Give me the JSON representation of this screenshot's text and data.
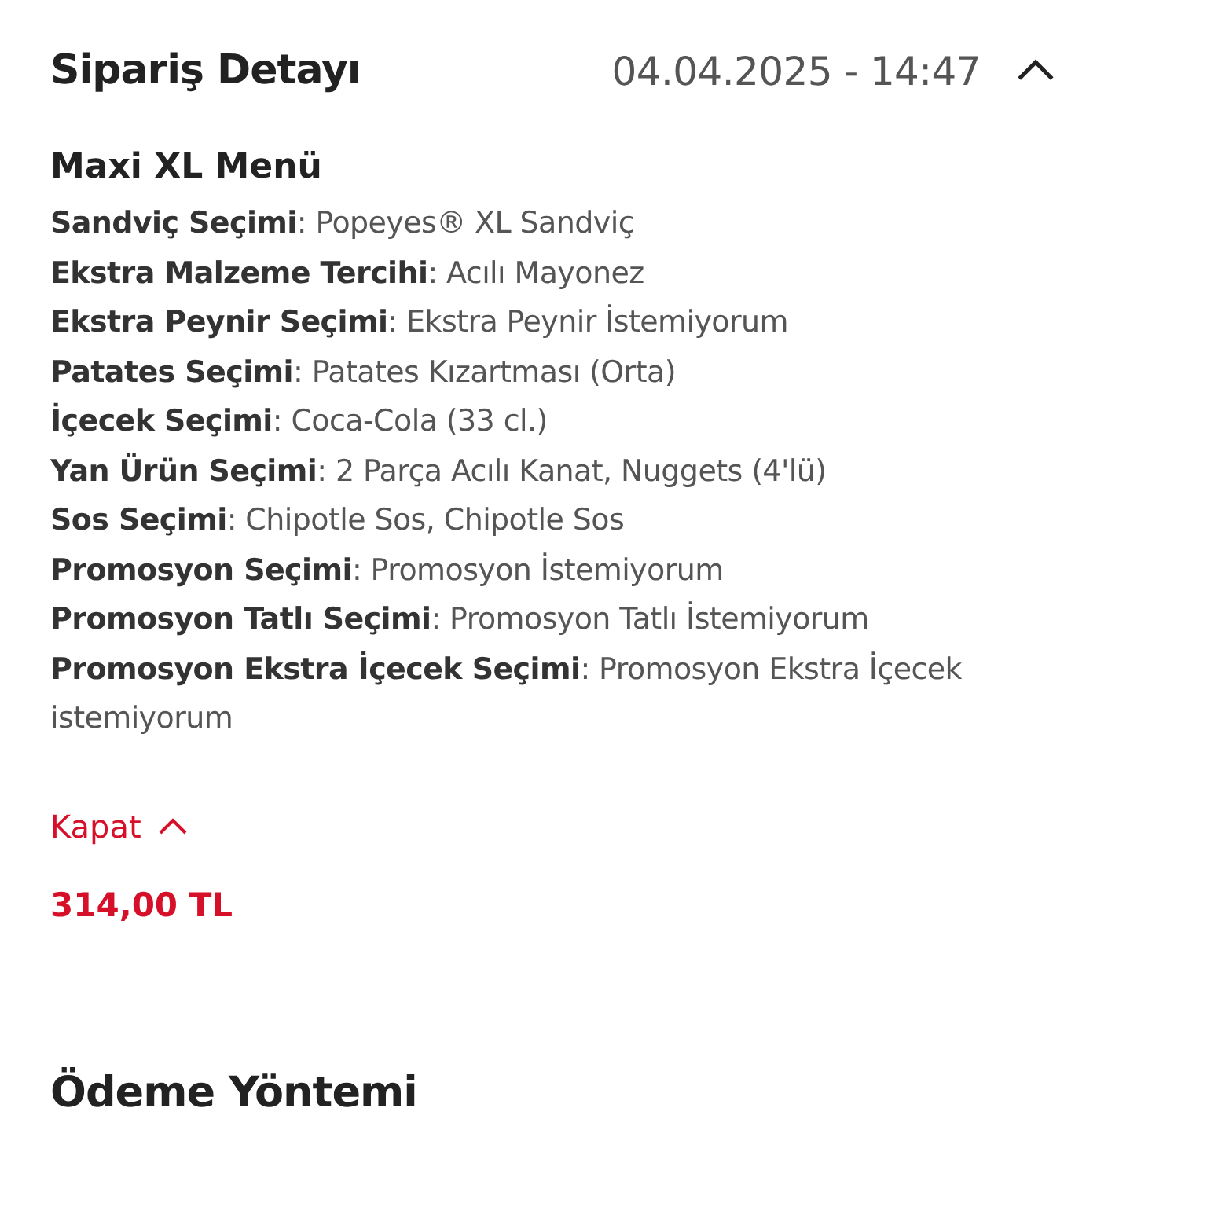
{
  "order_detail": {
    "title": "Sipariş Detayı",
    "date": "04.04.2025 - 14:47",
    "expanded": true,
    "item": {
      "name": "Maxi XL Menü",
      "options": [
        "**Sandviç Seçimi**: Popeyes® XL Sandviç",
        "**Ekstra Malzeme Tercihi**: Acılı Mayonez",
        "**Ekstra Peynir Seçimi**: Ekstra Peynir İstemiyorum",
        "**Patates Seçimi**: Patates Kızartması (Orta)",
        "**İçecek Seçimi**: Coca-Cola (33 cl.)",
        "**Yan Ürün Seçimi**: 2 Parça Acılı Kanat, Nuggets (4'lü)",
        "**Sos Seçimi**: Chipotle Sos, Chipotle Sos",
        "**Promosyon Seçimi**: Promosyon İstemiyorum",
        "**Promosyon Tatlı Seçimi**: Promosyon Tatlı İstemiyorum",
        "**Promosyon Ekstra İçecek Seçimi**: Promosyon Ekstra İçecek istemiyorum"
      ]
    },
    "collapse_link": "Kapat",
    "price": "314,00 TL"
  },
  "payment": {
    "title": "Ödeme Yöntemi"
  }
}
